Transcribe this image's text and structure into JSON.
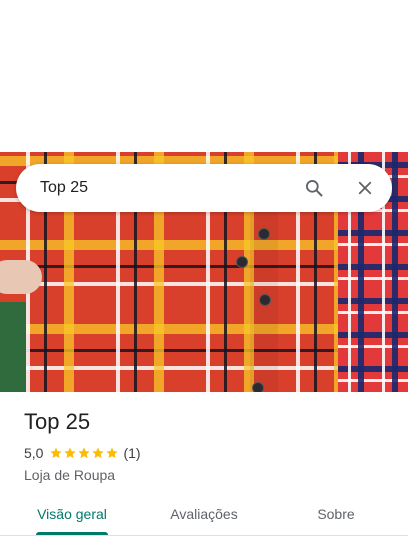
{
  "search": {
    "query": "Top 25"
  },
  "place": {
    "name": "Top 25",
    "rating": "5,0",
    "stars": 5,
    "reviews_count": "(1)",
    "category": "Loja de Roupa"
  },
  "tabs": [
    {
      "label": "Visão geral",
      "active": true
    },
    {
      "label": "Avaliações",
      "active": false
    },
    {
      "label": "Sobre",
      "active": false
    }
  ],
  "colors": {
    "accent": "#00796b",
    "star": "#fbbc04"
  },
  "icons": {
    "search": "search-icon",
    "close": "close-icon",
    "star": "star-icon"
  }
}
